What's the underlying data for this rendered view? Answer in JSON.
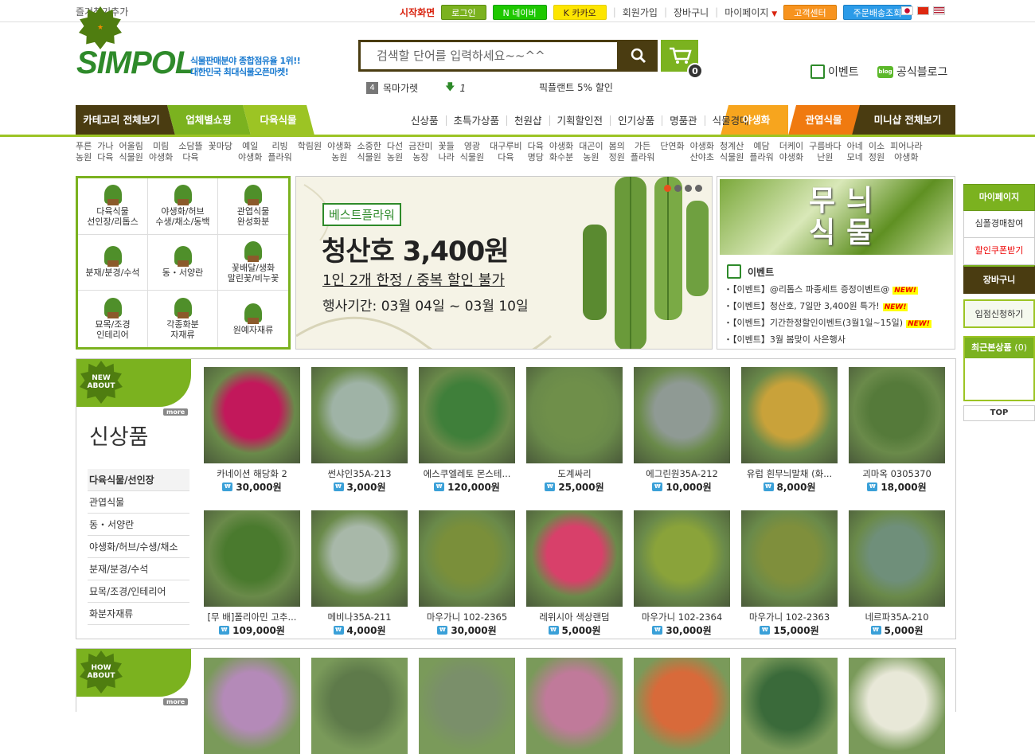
{
  "topbar": {
    "bookmark": "즐겨찾기추가",
    "home": "시작화면",
    "login": "로그인",
    "naver": "N 네이버",
    "kakao": "K 카카오",
    "join": "회원가입",
    "cart": "장바구니",
    "mypage": "마이페이지",
    "cs": "고객센터",
    "track": "주문배송조회"
  },
  "header": {
    "logo": "SIMPOL",
    "tagline1": "식물판매분야 종합점유율 1위!!",
    "tagline2": "대한민국 최대식물오픈마켓!",
    "search_placeholder": "검색할 단어를 입력하세요~~^^",
    "cart_count": "0",
    "rank_num": "4",
    "rank_word": "목마가렛",
    "rank_change": "1",
    "promo_text": "픽플랜트 5% 할인",
    "event_link": "이벤트",
    "blog_link": "공식블로그"
  },
  "nav": {
    "all_categories": "카테고리 전체보기",
    "business": "업체별쇼핑",
    "succulent": "다육식물",
    "middle": [
      "신상품",
      "초특가상품",
      "천원샵",
      "기획할인전",
      "인기상품",
      "명품관",
      "식물경매"
    ],
    "wildflower": "야생화",
    "foliage": "관엽식물",
    "minishop": "미니샵 전체보기"
  },
  "subnav": [
    "푸른\n농원",
    "가나\n다육",
    "어울림\n식물원",
    "미림\n야생화",
    "소담뜰\n다육",
    "꽃마당",
    "예일\n야생화",
    "리빙\n플라워",
    "학림원",
    "야생화\n농원",
    "소중한\n식물원",
    "다선\n농원",
    "금잔미\n농장",
    "꽃들\n나라",
    "영광\n식물원",
    "대구루비\n다육",
    "다육\n명당",
    "야생화\n화수분",
    "대곤이\n농원",
    "봄의\n정원",
    "가든\n플라워",
    "단연화",
    "야생화\n산야초",
    "청계산\n식물원",
    "예담\n플라워",
    "더케이\n야생화",
    "구름바다\n난원",
    "아네\n모네",
    "이소\n정원",
    "피어나라\n야생화"
  ],
  "categories": [
    {
      "label": "다육식물\n선인장/리톱스",
      "icon": "succulent-icon"
    },
    {
      "label": "야생화/허브\n수생/채소/동백",
      "icon": "herb-icon"
    },
    {
      "label": "관엽식물\n완성화분",
      "icon": "foliage-icon"
    },
    {
      "label": "분재/분경/수석",
      "icon": "bonsai-icon"
    },
    {
      "label": "동・서양란",
      "icon": "orchid-icon"
    },
    {
      "label": "꽃배달/생화\n말린꽃/비누꽃",
      "icon": "flower-icon"
    },
    {
      "label": "묘목/조경\n인테리어",
      "icon": "sapling-icon"
    },
    {
      "label": "각종화분\n자재류",
      "icon": "pot-icon"
    },
    {
      "label": "원예자재류",
      "icon": "material-icon"
    }
  ],
  "banner": {
    "badge": "베스트플라워",
    "headline": "청산호 3,400원",
    "line2": "1인 2개 한정 / 중복 할인 불가",
    "line3": "행사기간: 03월 04일 ~ 03월 10일"
  },
  "right_banner": {
    "title": "무늬식물",
    "event_head": "이벤트",
    "events": [
      {
        "text": "・【이벤트】@리톱스 파종세트 증정이벤트@",
        "new": "NEW!"
      },
      {
        "text": "・【이벤트】청산호, 7일만 3,400원 특가!",
        "new": "NEW!"
      },
      {
        "text": "・【이벤트】기간한정할인이벤트(3월1일~15일)",
        "new": "NEW!"
      },
      {
        "text": "・【이벤트】3월 봄맞이 사은행사",
        "new": ""
      }
    ]
  },
  "sidebar": {
    "mypage": "마이페이지",
    "auction": "심폴경매참여",
    "coupon": "할인쿠폰받기",
    "cart": "장바구니",
    "apply": "입점신청하기",
    "recent": "최근본상품",
    "recent_count": "(0)",
    "top": "TOP"
  },
  "new_section": {
    "badge": "NEW ABOUT",
    "more": "more",
    "title": "신상품",
    "subcats": [
      "다육식물/선인장",
      "관엽식물",
      "동・서양란",
      "야생화/허브/수생/채소",
      "분재/분경/수석",
      "묘목/조경/인테리어",
      "화분자재류"
    ],
    "products": [
      {
        "name": "카네이션 해당화 2",
        "price": "30,000원",
        "color": "#c2185b"
      },
      {
        "name": "썬샤인35A-213",
        "price": "3,000원",
        "color": "#9fb3a6"
      },
      {
        "name": "에스쿠엘레토 몬스테...",
        "price": "120,000원",
        "color": "#3f7f3a"
      },
      {
        "name": "도계싸리",
        "price": "25,000원",
        "color": "#6f8f4a"
      },
      {
        "name": "에그린원35A-212",
        "price": "10,000원",
        "color": "#8f9a94"
      },
      {
        "name": "유럽 흰무늬말채 (화...",
        "price": "8,000원",
        "color": "#c9a23a"
      },
      {
        "name": "괴마옥 0305370",
        "price": "18,000원",
        "color": "#557a3a"
      },
      {
        "name": "[무 배]폴리아민 고추...",
        "price": "109,000원",
        "color": "#4a7a2e"
      },
      {
        "name": "메비나35A-211",
        "price": "4,000원",
        "color": "#a8b8a9"
      },
      {
        "name": "마우가니 102-2365",
        "price": "30,000원",
        "color": "#7a8f3a"
      },
      {
        "name": "레위시아 색상랜덤",
        "price": "5,000원",
        "color": "#d8406a"
      },
      {
        "name": "마우가니 102-2364",
        "price": "30,000원",
        "color": "#8aa33a"
      },
      {
        "name": "마우가니 102-2363",
        "price": "15,000원",
        "color": "#7f8f3c"
      },
      {
        "name": "네르파35A-210",
        "price": "5,000원",
        "color": "#6f8f7a"
      }
    ]
  },
  "how_section": {
    "badge": "HOW ABOUT",
    "more": "more",
    "products": [
      {
        "color": "#b48ab8"
      },
      {
        "color": "#5e7a4a"
      },
      {
        "color": "#7a8f6a"
      },
      {
        "color": "#c07a9a"
      },
      {
        "color": "#d86a3a"
      },
      {
        "color": "#3a6a3a"
      },
      {
        "color": "#e8e8d8"
      }
    ]
  }
}
